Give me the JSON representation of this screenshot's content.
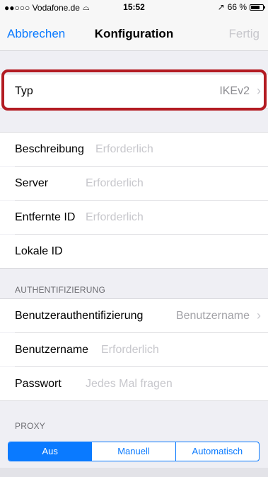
{
  "status_bar": {
    "carrier": "●●○○○ Vodafone.de",
    "time": "15:52",
    "battery": "66 %"
  },
  "nav": {
    "cancel_label": "Abbrechen",
    "title": "Konfiguration",
    "done_label": "Fertig"
  },
  "type_row": {
    "label": "Typ",
    "value": "IKEv2"
  },
  "fields": [
    {
      "label": "Beschreibung",
      "placeholder": "Erforderlich"
    },
    {
      "label": "Server",
      "placeholder": "Erforderlich"
    },
    {
      "label": "Entfernte ID",
      "placeholder": "Erforderlich"
    },
    {
      "label": "Lokale ID",
      "placeholder": ""
    }
  ],
  "auth": {
    "header": "AUTHENTIFIZIERUNG",
    "method": {
      "label": "Benutzerauthentifizierung",
      "value": "Benutzername"
    },
    "username": {
      "label": "Benutzername",
      "placeholder": "Erforderlich"
    },
    "password": {
      "label": "Passwort",
      "placeholder": "Jedes Mal fragen"
    }
  },
  "proxy": {
    "header": "PROXY",
    "options": [
      "Aus",
      "Manuell",
      "Automatisch"
    ],
    "selected": "Aus"
  },
  "colors": {
    "accent": "#0a7aff",
    "highlight": "#b31b22",
    "placeholder": "#c7c7cc",
    "background": "#efeff4"
  }
}
